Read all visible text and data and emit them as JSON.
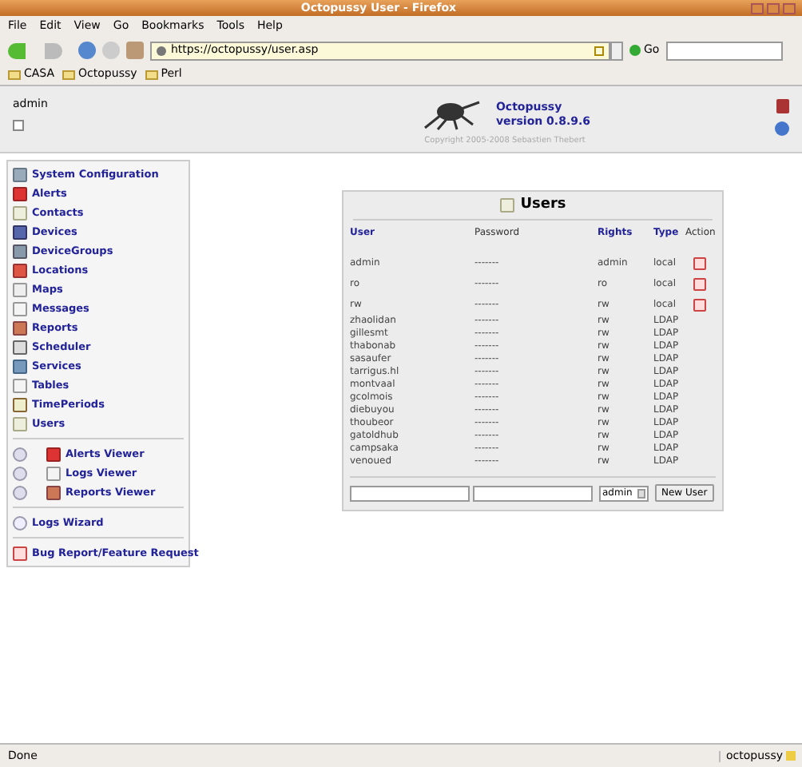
{
  "window": {
    "title": "Octopussy User - Firefox"
  },
  "menu": [
    "File",
    "Edit",
    "View",
    "Go",
    "Bookmarks",
    "Tools",
    "Help"
  ],
  "toolbar": {
    "url": "https://octopussy/user.asp",
    "go": "Go"
  },
  "bookmarks": [
    "CASA",
    "Octopussy",
    "Perl"
  ],
  "header": {
    "user": "admin",
    "app": "Octopussy",
    "version": "version 0.8.9.6",
    "copyright": "Copyright 2005-2008 Sebastien Thebert"
  },
  "sidebar": {
    "groups": [
      {
        "items": [
          {
            "label": "System Configuration"
          },
          {
            "label": "Alerts"
          },
          {
            "label": "Contacts"
          },
          {
            "label": "Devices"
          },
          {
            "label": "DeviceGroups"
          },
          {
            "label": "Locations"
          },
          {
            "label": "Maps"
          },
          {
            "label": "Messages"
          },
          {
            "label": "Reports"
          },
          {
            "label": "Scheduler"
          },
          {
            "label": "Services"
          },
          {
            "label": "Tables"
          },
          {
            "label": "TimePeriods"
          },
          {
            "label": "Users"
          }
        ]
      },
      {
        "items": [
          {
            "label": "Alerts Viewer"
          },
          {
            "label": "Logs Viewer"
          },
          {
            "label": "Reports Viewer"
          }
        ]
      },
      {
        "items": [
          {
            "label": "Logs Wizard"
          }
        ]
      },
      {
        "items": [
          {
            "label": "Bug Report/Feature Request"
          }
        ]
      }
    ]
  },
  "users_panel": {
    "title": "Users",
    "columns": [
      {
        "label": "User",
        "sortable": true
      },
      {
        "label": "Password",
        "sortable": false
      },
      {
        "label": "Rights",
        "sortable": true
      },
      {
        "label": "Type",
        "sortable": true
      },
      {
        "label": "Action",
        "sortable": false
      }
    ],
    "rows": [
      {
        "user": "admin",
        "password": "-------",
        "rights": "admin",
        "type": "local",
        "removable": true
      },
      {
        "user": "ro",
        "password": "-------",
        "rights": "ro",
        "type": "local",
        "removable": true
      },
      {
        "user": "rw",
        "password": "-------",
        "rights": "rw",
        "type": "local",
        "removable": true
      },
      {
        "user": "zhaolidan",
        "password": "-------",
        "rights": "rw",
        "type": "LDAP",
        "removable": false
      },
      {
        "user": "gillesmt",
        "password": "-------",
        "rights": "rw",
        "type": "LDAP",
        "removable": false
      },
      {
        "user": "thabonab",
        "password": "-------",
        "rights": "rw",
        "type": "LDAP",
        "removable": false
      },
      {
        "user": "sasaufer",
        "password": "-------",
        "rights": "rw",
        "type": "LDAP",
        "removable": false
      },
      {
        "user": "tarrigus.hl",
        "password": "-------",
        "rights": "rw",
        "type": "LDAP",
        "removable": false
      },
      {
        "user": "montvaal",
        "password": "-------",
        "rights": "rw",
        "type": "LDAP",
        "removable": false
      },
      {
        "user": "gcolmois",
        "password": "-------",
        "rights": "rw",
        "type": "LDAP",
        "removable": false
      },
      {
        "user": "diebuyou",
        "password": "-------",
        "rights": "rw",
        "type": "LDAP",
        "removable": false
      },
      {
        "user": "thoubeor",
        "password": "-------",
        "rights": "rw",
        "type": "LDAP",
        "removable": false
      },
      {
        "user": "gatoldhub",
        "password": "-------",
        "rights": "rw",
        "type": "LDAP",
        "removable": false
      },
      {
        "user": "campsaka",
        "password": "-------",
        "rights": "rw",
        "type": "LDAP",
        "removable": false
      },
      {
        "user": "venoued",
        "password": "-------",
        "rights": "rw",
        "type": "LDAP",
        "removable": false
      }
    ],
    "form": {
      "rights": "admin",
      "button": "New User"
    }
  },
  "status_bar": {
    "text": "Done",
    "host": "octopussy"
  }
}
